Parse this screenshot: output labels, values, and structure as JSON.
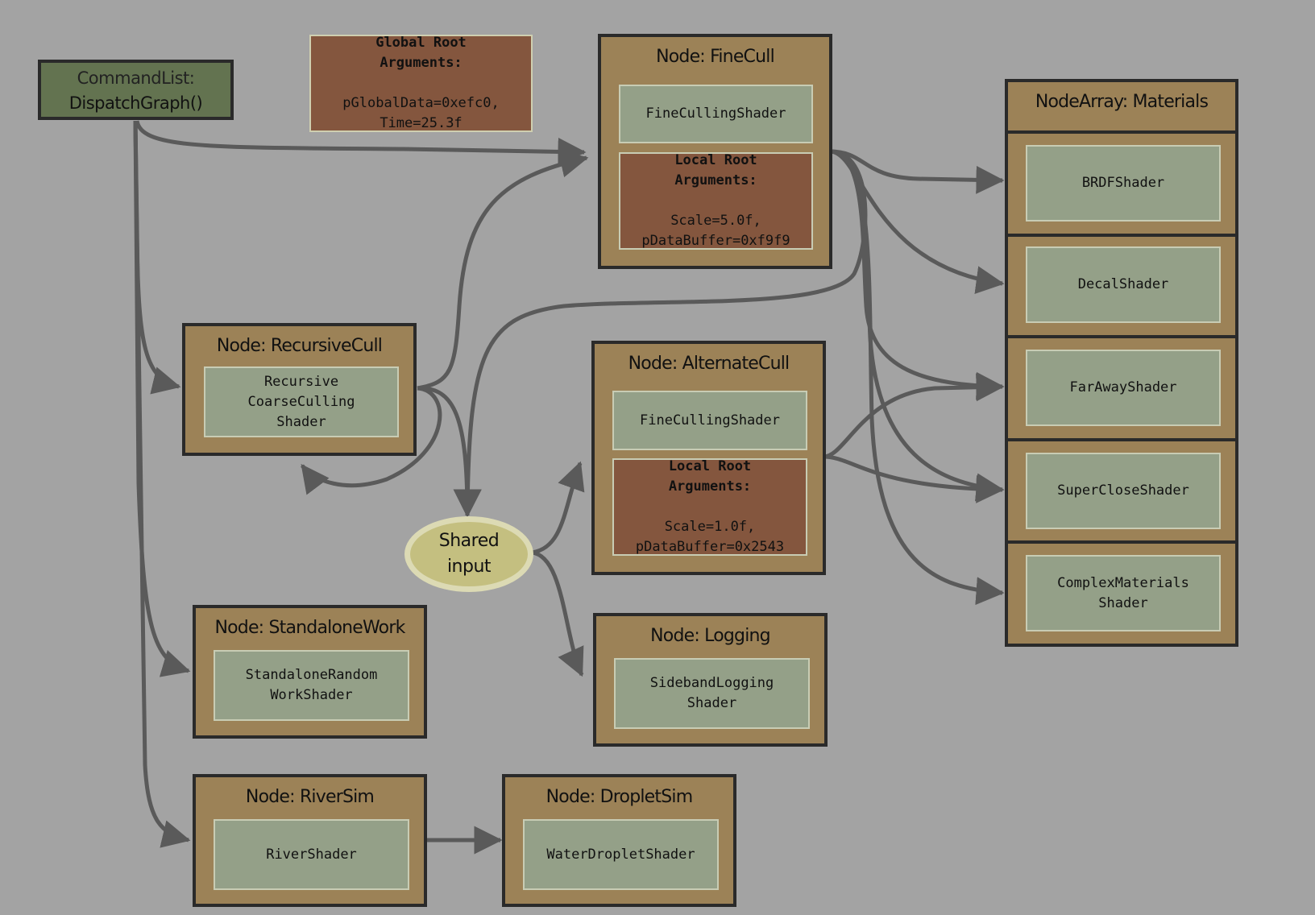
{
  "colors": {
    "background": "#a3a3a3",
    "node_fill": "#9c8257",
    "node_border": "#2a2a2a",
    "shader_fill": "#94a088",
    "args_fill": "#84563e",
    "command_list_fill": "#637350",
    "shared_input_fill": "#c4bf80",
    "edge_color": "#5a5a5a"
  },
  "command_list": {
    "line1": "CommandList:",
    "line2": "DispatchGraph()"
  },
  "global_root_args": {
    "heading": "Global Root\nArguments:",
    "values": "pGlobalData=0xefc0,\nTime=25.3f"
  },
  "nodes": {
    "fine_cull": {
      "title": "Node: FineCull",
      "shader": "FineCullingShader",
      "args_heading": "Local Root\nArguments:",
      "args_values": "Scale=5.0f,\npDataBuffer=0xf9f9"
    },
    "recursive_cull": {
      "title": "Node: RecursiveCull",
      "shader": "Recursive\nCoarseCulling\nShader"
    },
    "alternate_cull": {
      "title": "Node: AlternateCull",
      "shader": "FineCullingShader",
      "args_heading": "Local Root\nArguments:",
      "args_values": "Scale=1.0f,\npDataBuffer=0x2543"
    },
    "standalone_work": {
      "title": "Node: StandaloneWork",
      "shader": "StandaloneRandom\nWorkShader"
    },
    "logging": {
      "title": "Node: Logging",
      "shader": "SidebandLogging\nShader"
    },
    "river_sim": {
      "title": "Node: RiverSim",
      "shader": "RiverShader"
    },
    "droplet_sim": {
      "title": "Node: DropletSim",
      "shader": "WaterDropletShader"
    }
  },
  "node_array": {
    "title": "NodeArray: Materials",
    "shaders": [
      "BRDFShader",
      "DecalShader",
      "FarAwayShader",
      "SuperCloseShader",
      "ComplexMaterials\nShader"
    ]
  },
  "shared_input": {
    "label": "Shared\ninput"
  },
  "edges": [
    {
      "from": "command_list",
      "to": "fine_cull"
    },
    {
      "from": "command_list",
      "to": "recursive_cull"
    },
    {
      "from": "command_list",
      "to": "standalone_work"
    },
    {
      "from": "command_list",
      "to": "river_sim"
    },
    {
      "from": "recursive_cull",
      "to": "fine_cull"
    },
    {
      "from": "recursive_cull",
      "to": "recursive_cull"
    },
    {
      "from": "recursive_cull",
      "to": "shared_input"
    },
    {
      "from": "fine_cull",
      "to": "shared_input"
    },
    {
      "from": "fine_cull",
      "to": "BRDFShader"
    },
    {
      "from": "fine_cull",
      "to": "DecalShader"
    },
    {
      "from": "fine_cull",
      "to": "FarAwayShader"
    },
    {
      "from": "fine_cull",
      "to": "SuperCloseShader"
    },
    {
      "from": "fine_cull",
      "to": "ComplexMaterialsShader"
    },
    {
      "from": "shared_input",
      "to": "alternate_cull"
    },
    {
      "from": "shared_input",
      "to": "logging"
    },
    {
      "from": "alternate_cull",
      "to": "FarAwayShader"
    },
    {
      "from": "alternate_cull",
      "to": "SuperCloseShader"
    },
    {
      "from": "river_sim",
      "to": "droplet_sim"
    }
  ]
}
